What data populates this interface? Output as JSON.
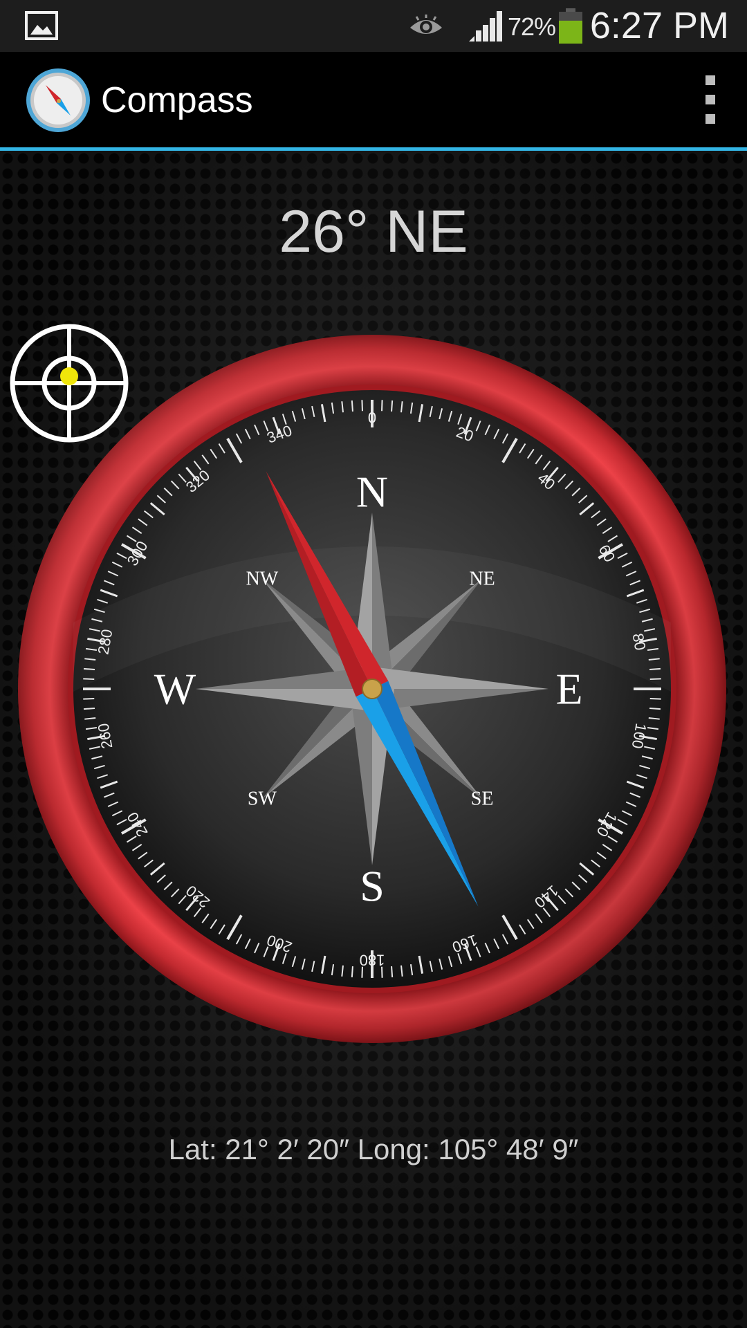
{
  "status_bar": {
    "battery_percent": "72%",
    "time": "6:27 PM",
    "icons": [
      "gallery-icon",
      "eye-icon",
      "signal-icon",
      "battery-icon"
    ],
    "battery_color": "#7cb518"
  },
  "action_bar": {
    "title": "Compass",
    "icons": [
      "compass-logo-icon",
      "overflow-menu-icon"
    ],
    "accent_color": "#33b5e5"
  },
  "compass": {
    "heading_text": "26° NE",
    "heading_degrees": 26,
    "cardinals": [
      "N",
      "E",
      "S",
      "W"
    ],
    "intercardinals": [
      "NE",
      "SE",
      "SW",
      "NW"
    ],
    "degree_labels": [
      "0",
      "20",
      "40",
      "60",
      "80",
      "100",
      "120",
      "140",
      "160",
      "180",
      "200",
      "220",
      "240",
      "260",
      "280",
      "300",
      "320",
      "340"
    ],
    "bezel_color": "#e0363c",
    "needle_north_color": "#d0262c",
    "needle_south_color": "#1aa0e8"
  },
  "location": {
    "text": "Lat: 21° 2′ 20″ Long: 105° 48′ 9″"
  },
  "locate_button": {
    "icon": "crosshair-icon",
    "dot_color": "#f0e60a"
  }
}
